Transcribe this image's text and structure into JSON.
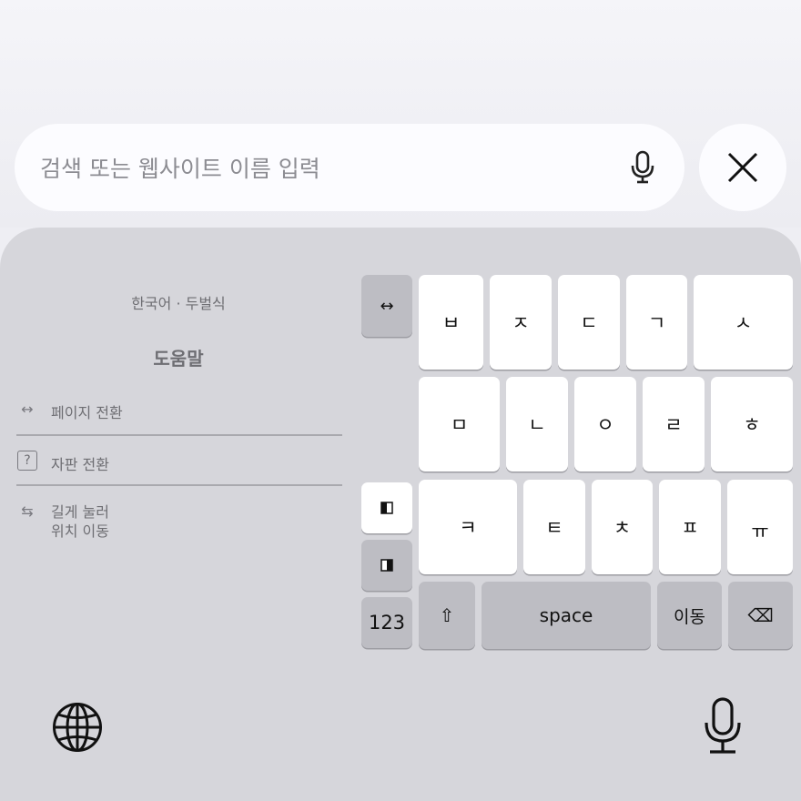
{
  "search": {
    "placeholder": "검색 또는 웹사이트 이름 입력"
  },
  "keyboard": {
    "language_label": "한국어 · 두벌식",
    "help_title": "도움말",
    "help_items": [
      {
        "icon": "arrows-horizontal-icon",
        "label": "페이지 전환"
      },
      {
        "icon": "question-box-icon",
        "label": "자판 전환"
      },
      {
        "icon": "swap-arrows-icon",
        "label_line1": "길게 눌러",
        "label_line2": "위치 이동"
      }
    ],
    "side_keys": {
      "page_switch": "↔",
      "numbers": "123"
    },
    "row1": [
      "ㅂ",
      "ㅈ",
      "ㄷ",
      "ㄱ",
      "ㅅ"
    ],
    "row2": [
      "ㅁ",
      "ㄴ",
      "ㅇ",
      "ㄹ",
      "ㅎ"
    ],
    "row3": [
      "ㅋ",
      "ㅌ",
      "ㅊ",
      "ㅍ",
      "ㅠ"
    ],
    "bottom": {
      "shift": "⇧",
      "space": "space",
      "go": "이동",
      "delete": "⌫"
    }
  },
  "colors": {
    "keyboard_bg": "#d6d6db",
    "key_bg": "#ffffff",
    "function_key_bg": "#bdbdc3"
  }
}
